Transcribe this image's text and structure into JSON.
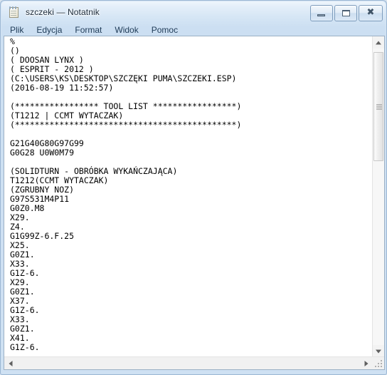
{
  "window": {
    "title": "szczeki — Notatnik",
    "app_icon": "notepad-icon",
    "controls": {
      "minimize_label": "—",
      "maximize_label": "❐",
      "close_label": "✕"
    }
  },
  "menu": {
    "items": [
      {
        "label": "Plik"
      },
      {
        "label": "Edycja"
      },
      {
        "label": "Format"
      },
      {
        "label": "Widok"
      },
      {
        "label": "Pomoc"
      }
    ]
  },
  "editor": {
    "content": "%\n()\n( DOOSAN LYNX )\n( ESPRIT - 2012 )\n(C:\\USERS\\KS\\DESKTOP\\SZCZĘKI PUMA\\SZCZEKI.ESP)\n(2016-08-19 11:52:57)\n\n(***************** TOOL LIST *****************)\n(T1212 | CCMT WYTACZAK)\n(*********************************************)\n\nG21G40G80G97G99\nG0G28 U0W0M79\n\n(SOLIDTURN - OBRÓBKA WYKAŃCZAJĄCA)\nT1212(CCMT WYTACZAK)\n(ZGRUBNY NOZ)\nG97S531M4P11\nG0Z0.M8\nX29.\nZ4.\nG1G99Z-6.F.25\nX25.\nG0Z1.\nX33.\nG1Z-6.\nX29.\nG0Z1.\nX37.\nG1Z-6.\nX33.\nG0Z1.\nX41.\nG1Z-6.",
    "lines": [
      "%",
      "()",
      "( DOOSAN LYNX )",
      "( ESPRIT - 2012 )",
      "(C:\\USERS\\KS\\DESKTOP\\SZCZĘKI PUMA\\SZCZEKI.ESP)",
      "(2016-08-19 11:52:57)",
      "",
      "(***************** TOOL LIST *****************)",
      "(T1212 | CCMT WYTACZAK)",
      "(*********************************************)",
      "",
      "G21G40G80G97G99",
      "G0G28 U0W0M79",
      "",
      "(SOLIDTURN - OBRÓBKA WYKAŃCZAJĄCA)",
      "T1212(CCMT WYTACZAK)",
      "(ZGRUBNY NOZ)",
      "G97S531M4P11",
      "G0Z0.M8",
      "X29.",
      "Z4.",
      "G1G99Z-6.F.25",
      "X25.",
      "G0Z1.",
      "X33.",
      "G1Z-6.",
      "X29.",
      "G0Z1.",
      "X37.",
      "G1Z-6.",
      "X33.",
      "G0Z1.",
      "X41.",
      "G1Z-6."
    ]
  },
  "scrollbars": {
    "vertical": {
      "up_arrow": "scroll-up-arrow",
      "down_arrow": "scroll-down-arrow",
      "thumb": "vertical-scroll-thumb"
    },
    "horizontal": {
      "left_arrow": "scroll-left-arrow",
      "right_arrow": "scroll-right-arrow"
    },
    "resize_grip": "window-resize-grip"
  },
  "colors": {
    "frame": "#cfe0f2",
    "frame_border": "#9cb7d4",
    "title_text": "#1c2b3a",
    "menu_text": "#1f3b57",
    "editor_bg": "#ffffff",
    "editor_text": "#000000",
    "scrollbar_bg": "#f1f1f1",
    "scrollbar_thumb": "#e8e8e8"
  }
}
